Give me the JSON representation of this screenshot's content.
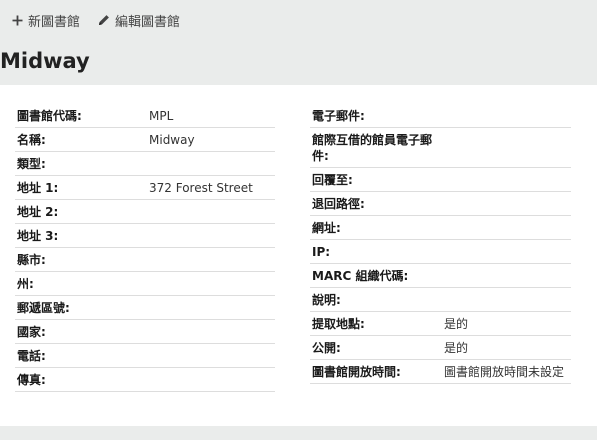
{
  "toolbar": {
    "new_label": "新圖書館",
    "edit_label": "編輯圖書館"
  },
  "page_title": "Midway",
  "left_fields": [
    {
      "label": "圖書館代碼:",
      "value": "MPL"
    },
    {
      "label": "名稱:",
      "value": "Midway"
    },
    {
      "label": "類型:",
      "value": ""
    },
    {
      "label": "地址 1:",
      "value": "372 Forest Street"
    },
    {
      "label": "地址 2:",
      "value": ""
    },
    {
      "label": "地址 3:",
      "value": ""
    },
    {
      "label": "縣市:",
      "value": ""
    },
    {
      "label": "州:",
      "value": ""
    },
    {
      "label": "郵遞區號:",
      "value": ""
    },
    {
      "label": "國家:",
      "value": ""
    },
    {
      "label": "電話:",
      "value": ""
    },
    {
      "label": "傳真:",
      "value": ""
    }
  ],
  "right_fields": [
    {
      "label": "電子郵件:",
      "value": ""
    },
    {
      "label": "館際互借的館員電子郵件:",
      "value": ""
    },
    {
      "label": "回覆至:",
      "value": ""
    },
    {
      "label": "退回路徑:",
      "value": ""
    },
    {
      "label": "網址:",
      "value": ""
    },
    {
      "label": "IP:",
      "value": ""
    },
    {
      "label": "MARC 組織代碼:",
      "value": ""
    },
    {
      "label": "說明:",
      "value": ""
    },
    {
      "label": "提取地點:",
      "value": "是的"
    },
    {
      "label": "公開:",
      "value": "是的"
    },
    {
      "label": "圖書館開放時間:",
      "value": "圖書館開放時間未設定"
    }
  ],
  "icons": {
    "new": "plus-icon",
    "edit": "pencil-icon"
  }
}
